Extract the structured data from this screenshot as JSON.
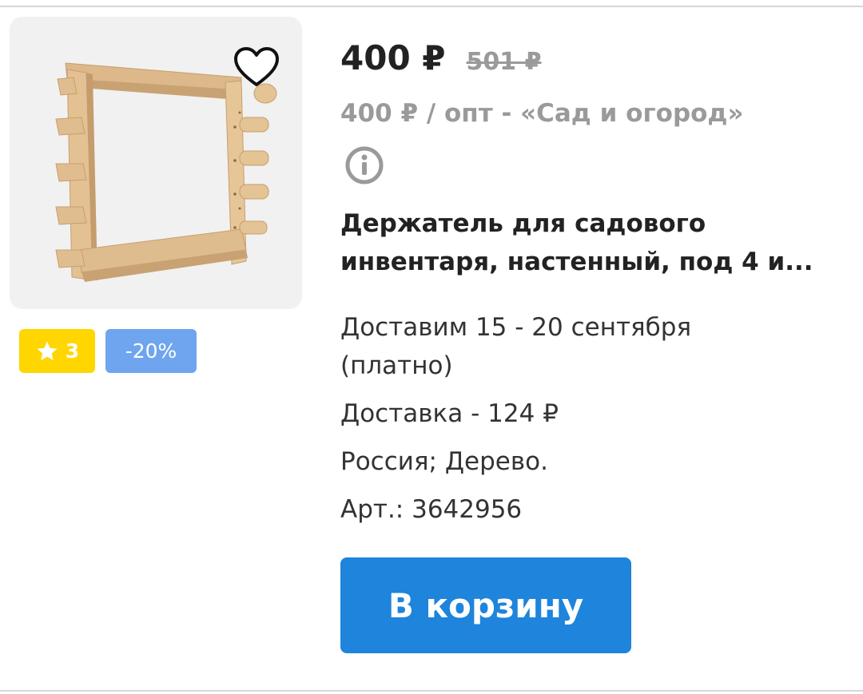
{
  "product": {
    "image_alt": "wooden-wall-tool-holder",
    "favorite_icon": "heart-outline-icon",
    "rating": "3",
    "discount": "-20%",
    "price": "400 ₽",
    "old_price": "501 ₽",
    "wholesale_price": "400 ₽ / опт - «Сад и огород»",
    "info_icon": "info-icon",
    "title": "Держатель для садового инвентаря, настенный, под 4 и...",
    "delivery_date": "Доставим 15 - 20 сентября",
    "delivery_note": "(платно)",
    "delivery_cost": "Доставка - 124 ₽",
    "origin": "Россия; Дерево.",
    "article": "Арт.: 3642956",
    "cart_button": "В корзину"
  },
  "colors": {
    "rating_badge": "#ffd600",
    "discount_badge": "#6fa5ee",
    "cart_button": "#1e84dc"
  }
}
